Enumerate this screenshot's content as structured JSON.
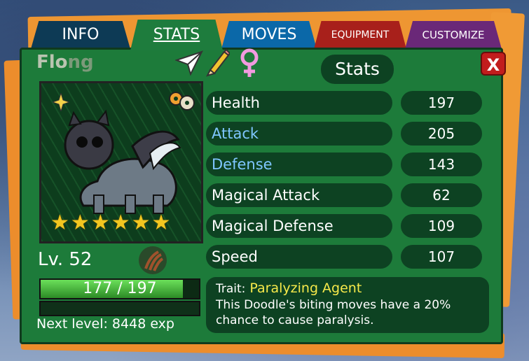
{
  "tabs": {
    "info": "INFO",
    "stats": "STATS",
    "moves": "MOVES",
    "equipment": "EQUIPMENT",
    "customize": "CUSTOMIZE",
    "active": "STATS"
  },
  "doodle": {
    "name_main": "Flo",
    "name_faded": "ng",
    "stars": 6,
    "level_text": "Lv. 52",
    "hp_current": 177,
    "hp_max": 197,
    "hp_text": "177 / 197",
    "next_level_text": "Next level: 8448 exp"
  },
  "stats_panel": {
    "heading": "Stats",
    "close_label": "X",
    "rows": [
      {
        "label": "Health",
        "value": "197"
      },
      {
        "label": "Attack",
        "value": "205"
      },
      {
        "label": "Defense",
        "value": "143"
      },
      {
        "label": "Magical Attack",
        "value": "62"
      },
      {
        "label": "Magical Defense",
        "value": "109"
      },
      {
        "label": "Speed",
        "value": "107"
      }
    ]
  },
  "trait": {
    "prefix": "Trait:",
    "name": "Paralyzing Agent",
    "description": "This Doodle's biting moves have a 20%\nchance to cause paralysis."
  },
  "colors": {
    "panel": "#1d7b3a",
    "row_bg": "#0d4222",
    "boosted_stat": "#7fc6ff",
    "trait_name": "#f7e94a",
    "star": "#f3c620",
    "close": "#c21d1d"
  },
  "icons": [
    "paper-plane-icon",
    "pencil-icon",
    "female-icon",
    "sparkle-icon",
    "donut-item-icon",
    "claw-type-icon",
    "star-icon"
  ]
}
